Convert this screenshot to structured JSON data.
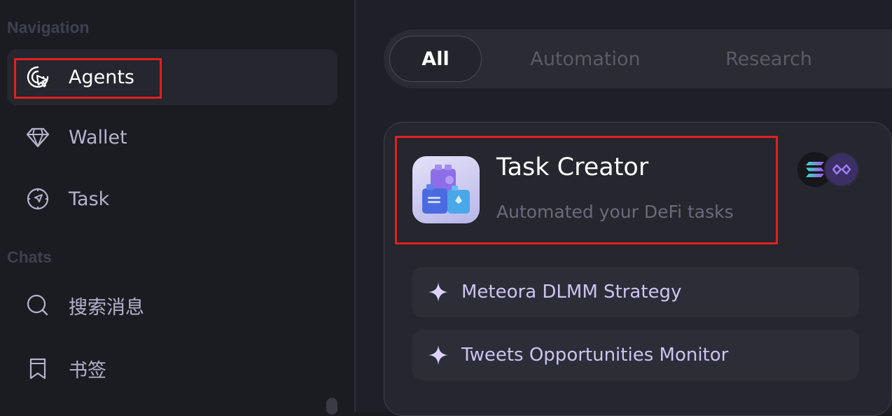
{
  "sidebar": {
    "navigation_title": "Navigation",
    "nav_items": [
      {
        "label": "Agents",
        "icon": "agents-cursor-icon",
        "active": true
      },
      {
        "label": "Wallet",
        "icon": "diamond-icon",
        "active": false
      },
      {
        "label": "Task",
        "icon": "compass-send-icon",
        "active": false
      }
    ],
    "chats_title": "Chats",
    "chat_items": [
      {
        "label": "搜索消息",
        "icon": "search-icon"
      },
      {
        "label": "书签",
        "icon": "bookmark-icon"
      }
    ]
  },
  "tabs": [
    {
      "label": "All",
      "active": true
    },
    {
      "label": "Automation",
      "active": false
    },
    {
      "label": "Research",
      "active": false
    }
  ],
  "agent_card": {
    "title": "Task Creator",
    "subtitle": "Automated your DeFi tasks",
    "icon": "blocks-icon",
    "chains": [
      "solana-icon",
      "polygon-icon"
    ],
    "strategies": [
      {
        "label": "Meteora DLMM Strategy",
        "icon": "sparkle-icon"
      },
      {
        "label": "Tweets Opportunities Monitor",
        "icon": "sparkle-icon"
      }
    ]
  },
  "colors": {
    "highlight_box": "#e02020",
    "accent_purple": "#cdc3f2",
    "background": "#1b1c22"
  }
}
